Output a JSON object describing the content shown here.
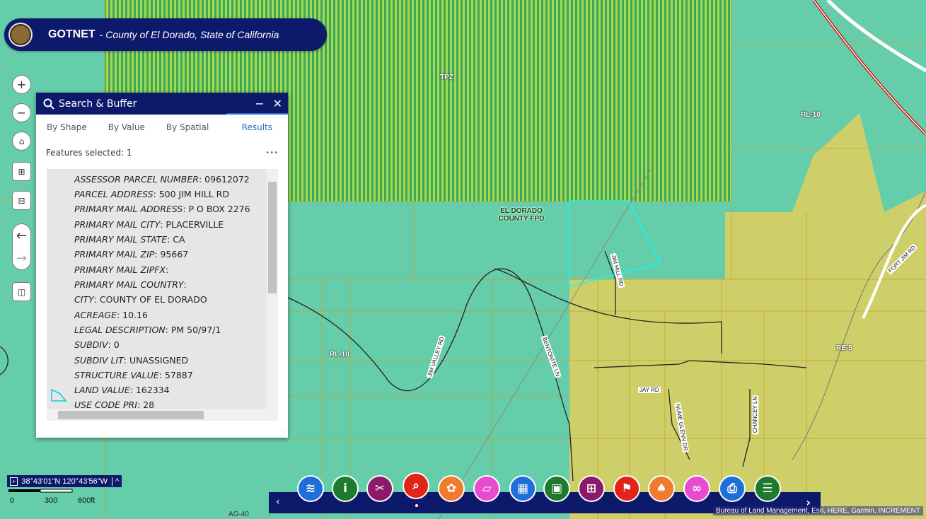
{
  "header": {
    "title": "GOTNET",
    "subtitle": "- County of El Dorado, State of California"
  },
  "map": {
    "zone_labels": [
      "TPZ",
      "RL-10",
      "EL DORADO COUNTY FPD",
      "RL-10",
      "RE-5",
      "AG-40"
    ],
    "road_labels": [
      "JIM HILL RD",
      "JIM VALLEY RD",
      "BENTONITE LN",
      "JAY RD",
      "NUME GLENN DR",
      "CHANCEY LN",
      "FORT JIM RD"
    ],
    "colors": {
      "zone_green": "#66cdaa",
      "zone_tpz": "#9ad55a",
      "zone_yellow": "#cfcf6a",
      "selection": "#00ffff"
    }
  },
  "panel": {
    "title": "Search & Buffer",
    "tabs": [
      "By Shape",
      "By Value",
      "By Spatial",
      "Results"
    ],
    "active_tab": "Results",
    "features_selected": "Features selected: 1",
    "more": "•••",
    "rows": [
      {
        "key": "ASSESSOR PARCEL NUMBER",
        "value": ": 09612072"
      },
      {
        "key": "PARCEL ADDRESS",
        "value": ": 500 JIM HILL RD"
      },
      {
        "key": "PRIMARY MAIL ADDRESS",
        "value": ": P O BOX 2276"
      },
      {
        "key": "PRIMARY MAIL CITY",
        "value": ": PLACERVILLE"
      },
      {
        "key": "PRIMARY MAIL STATE",
        "value": ": CA"
      },
      {
        "key": "PRIMARY MAIL ZIP",
        "value": ": 95667"
      },
      {
        "key": "PRIMARY MAIL ZIPFX",
        "value": ":"
      },
      {
        "key": "PRIMARY MAIL COUNTRY",
        "value": ":"
      },
      {
        "key": "CITY",
        "value": ": COUNTY OF EL DORADO"
      },
      {
        "key": "ACREAGE",
        "value": ": 10.16"
      },
      {
        "key": "LEGAL DESCRIPTION",
        "value": ": PM 50/97/1"
      },
      {
        "key": "SUBDIV",
        "value": ": 0"
      },
      {
        "key": "SUBDIV LIT",
        "value": ": UNASSIGNED"
      },
      {
        "key": "STRUCTURE VALUE",
        "value": ": 57887"
      },
      {
        "key": "LAND VALUE",
        "value": ": 162334"
      },
      {
        "key": "USE CODE PRI",
        "value": ": 28"
      }
    ]
  },
  "coordinates": "38°43'01\"N 120°43'56\"W",
  "scale": {
    "labels": [
      "0",
      "300",
      "600ft"
    ]
  },
  "toolbar": {
    "tools": [
      {
        "icon": "layers-icon",
        "color": "#1e6fd9"
      },
      {
        "icon": "info-icon",
        "color": "#1e7a2e"
      },
      {
        "icon": "scissors-icon",
        "color": "#8b1a6b"
      },
      {
        "icon": "search-icon",
        "color": "#e2231a"
      },
      {
        "icon": "palette-icon",
        "color": "#f07b2f"
      },
      {
        "icon": "ruler-icon",
        "color": "#e64bd0"
      },
      {
        "icon": "grid-select-icon",
        "color": "#1e6fd9"
      },
      {
        "icon": "parcel-icon",
        "color": "#1e7a2e"
      },
      {
        "icon": "basemap-icon",
        "color": "#8b1a6b"
      },
      {
        "icon": "flag-icon",
        "color": "#e2231a"
      },
      {
        "icon": "graduation-icon",
        "color": "#f07b2f"
      },
      {
        "icon": "link-icon",
        "color": "#e64bd0"
      },
      {
        "icon": "print-icon",
        "color": "#1e6fd9"
      },
      {
        "icon": "table-icon",
        "color": "#1e7a2e"
      }
    ]
  },
  "attribution": "Bureau of Land Management, Esri, HERE, Garmin, INCREMENT"
}
